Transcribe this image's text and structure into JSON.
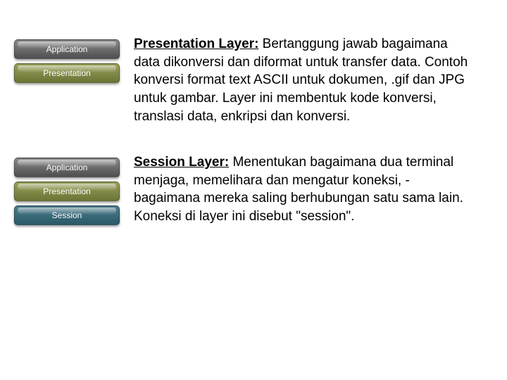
{
  "sections": [
    {
      "layers": [
        {
          "label": "Application",
          "cls": "gray"
        },
        {
          "label": "Presentation",
          "cls": "olive"
        }
      ],
      "title": "Presentation Layer:",
      "body": " Bertanggung jawab bagaimana data dikonversi dan diformat untuk transfer data. Contoh konversi format text ASCII untuk dokumen, .gif dan JPG untuk gambar. Layer ini membentuk kode konversi, translasi data, enkripsi dan konversi."
    },
    {
      "layers": [
        {
          "label": "Application",
          "cls": "gray"
        },
        {
          "label": "Presentation",
          "cls": "olive"
        },
        {
          "label": "Session",
          "cls": "teal"
        }
      ],
      "title": "Session Layer:",
      "body": " Menentukan bagaimana dua terminal menjaga, memelihara dan mengatur koneksi, - bagaimana mereka saling berhubungan satu sama lain. Koneksi di layer ini disebut \"session\"."
    }
  ]
}
